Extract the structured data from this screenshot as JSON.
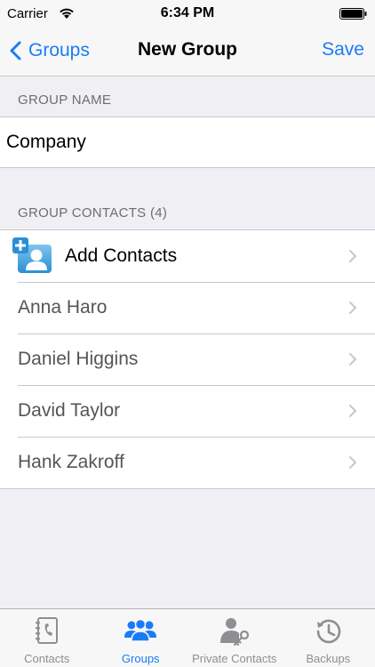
{
  "status_bar": {
    "carrier": "Carrier",
    "time": "6:34 PM"
  },
  "nav": {
    "back_label": "Groups",
    "title": "New Group",
    "save_label": "Save"
  },
  "group_name": {
    "header": "GROUP NAME",
    "value": "Company"
  },
  "group_contacts": {
    "header": "GROUP CONTACTS (4)",
    "add_label": "Add Contacts",
    "contacts": [
      {
        "name": "Anna Haro"
      },
      {
        "name": "Daniel Higgins"
      },
      {
        "name": "David Taylor"
      },
      {
        "name": "Hank Zakroff"
      }
    ]
  },
  "tabs": [
    {
      "label": "Contacts",
      "icon": "contacts-book-icon",
      "active": false
    },
    {
      "label": "Groups",
      "icon": "groups-icon",
      "active": true
    },
    {
      "label": "Private Contacts",
      "icon": "private-contacts-icon",
      "active": false
    },
    {
      "label": "Backups",
      "icon": "backups-history-icon",
      "active": false
    }
  ],
  "colors": {
    "accent": "#1a7cf5",
    "background": "#efeff4",
    "inactive_tab": "#8e8e93"
  }
}
